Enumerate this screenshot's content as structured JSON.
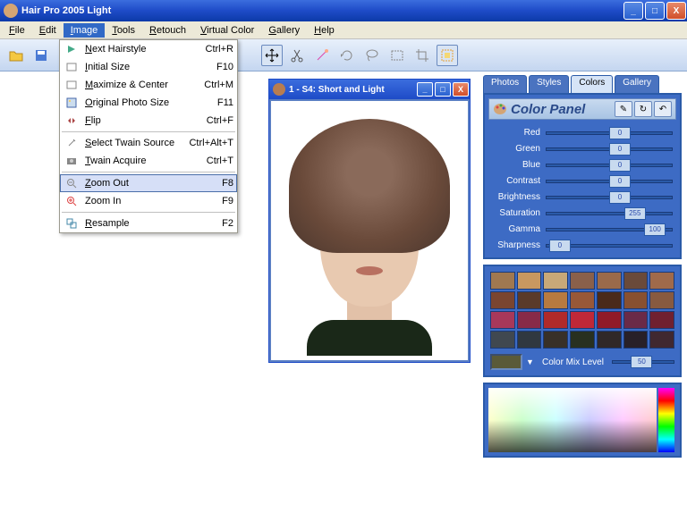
{
  "title": "Hair Pro 2005  Light",
  "menubar": [
    "File",
    "Edit",
    "Image",
    "Tools",
    "Retouch",
    "Virtual Color",
    "Gallery",
    "Help"
  ],
  "active_menu": "Image",
  "dropdown": [
    {
      "icon": "arrow-right",
      "label": "Next Hairstyle",
      "underline": "N",
      "shortcut": "Ctrl+R"
    },
    {
      "icon": "square",
      "label": "Initial Size",
      "underline": "I",
      "shortcut": "F10"
    },
    {
      "icon": "square",
      "label": "Maximize & Center",
      "underline": "M",
      "shortcut": "Ctrl+M"
    },
    {
      "icon": "photo",
      "label": "Original Photo Size",
      "underline": "O",
      "shortcut": "F11"
    },
    {
      "icon": "flip",
      "label": "Flip",
      "underline": "F",
      "shortcut": "Ctrl+F"
    },
    {
      "sep": true
    },
    {
      "icon": "tools",
      "label": "Select Twain Source",
      "underline": "S",
      "shortcut": "Ctrl+Alt+T"
    },
    {
      "icon": "camera",
      "label": "Twain Acquire",
      "underline": "T",
      "shortcut": "Ctrl+T"
    },
    {
      "sep": true
    },
    {
      "icon": "zoom-out",
      "label": "Zoom Out",
      "underline": "Z",
      "shortcut": "F8",
      "hover": true
    },
    {
      "icon": "zoom-in",
      "label": "Zoom In",
      "underline": "",
      "shortcut": "F9"
    },
    {
      "sep": true
    },
    {
      "icon": "resample",
      "label": "Resample",
      "underline": "R",
      "shortcut": "F2"
    }
  ],
  "child_window": {
    "title": "1 - S4: Short and Light"
  },
  "tabs": [
    "Photos",
    "Styles",
    "Colors",
    "Gallery"
  ],
  "active_tab": "Colors",
  "panel_title": "Color Panel",
  "sliders": [
    {
      "label": "Red",
      "value": 0,
      "pos": 50
    },
    {
      "label": "Green",
      "value": 0,
      "pos": 50
    },
    {
      "label": "Blue",
      "value": 0,
      "pos": 50
    },
    {
      "label": "Contrast",
      "value": 0,
      "pos": 50
    },
    {
      "label": "Brightness",
      "value": 0,
      "pos": 50
    },
    {
      "label": "Saturation",
      "value": 255,
      "pos": 62
    },
    {
      "label": "Gamma",
      "value": 100,
      "pos": 78
    },
    {
      "label": "Sharpness",
      "value": 0,
      "pos": 2
    }
  ],
  "swatches": [
    "#a07850",
    "#c89860",
    "#c8a878",
    "#8a604a",
    "#9a6a4a",
    "#6a4a3a",
    "#a06a4a",
    "#7a4530",
    "#5a3a2a",
    "#b87a40",
    "#985838",
    "#4a2a1a",
    "#885030",
    "#885a40",
    "#a8385a",
    "#882a48",
    "#b02a2a",
    "#c02838",
    "#901a28",
    "#6a2a48",
    "#702030",
    "#404850",
    "#303840",
    "#383028",
    "#283020",
    "#302828",
    "#282028",
    "#402830"
  ],
  "mix": {
    "label": "Color Mix Level",
    "value": 50,
    "preview": "#5a5a38"
  }
}
